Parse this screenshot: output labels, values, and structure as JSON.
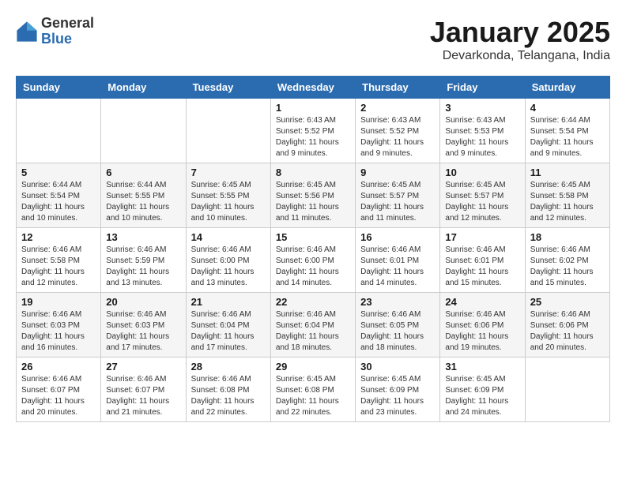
{
  "header": {
    "logo_general": "General",
    "logo_blue": "Blue",
    "month_title": "January 2025",
    "location": "Devarkonda, Telangana, India"
  },
  "days_of_week": [
    "Sunday",
    "Monday",
    "Tuesday",
    "Wednesday",
    "Thursday",
    "Friday",
    "Saturday"
  ],
  "weeks": [
    [
      {
        "day": "",
        "info": ""
      },
      {
        "day": "",
        "info": ""
      },
      {
        "day": "",
        "info": ""
      },
      {
        "day": "1",
        "info": "Sunrise: 6:43 AM\nSunset: 5:52 PM\nDaylight: 11 hours and 9 minutes."
      },
      {
        "day": "2",
        "info": "Sunrise: 6:43 AM\nSunset: 5:52 PM\nDaylight: 11 hours and 9 minutes."
      },
      {
        "day": "3",
        "info": "Sunrise: 6:43 AM\nSunset: 5:53 PM\nDaylight: 11 hours and 9 minutes."
      },
      {
        "day": "4",
        "info": "Sunrise: 6:44 AM\nSunset: 5:54 PM\nDaylight: 11 hours and 9 minutes."
      }
    ],
    [
      {
        "day": "5",
        "info": "Sunrise: 6:44 AM\nSunset: 5:54 PM\nDaylight: 11 hours and 10 minutes."
      },
      {
        "day": "6",
        "info": "Sunrise: 6:44 AM\nSunset: 5:55 PM\nDaylight: 11 hours and 10 minutes."
      },
      {
        "day": "7",
        "info": "Sunrise: 6:45 AM\nSunset: 5:55 PM\nDaylight: 11 hours and 10 minutes."
      },
      {
        "day": "8",
        "info": "Sunrise: 6:45 AM\nSunset: 5:56 PM\nDaylight: 11 hours and 11 minutes."
      },
      {
        "day": "9",
        "info": "Sunrise: 6:45 AM\nSunset: 5:57 PM\nDaylight: 11 hours and 11 minutes."
      },
      {
        "day": "10",
        "info": "Sunrise: 6:45 AM\nSunset: 5:57 PM\nDaylight: 11 hours and 12 minutes."
      },
      {
        "day": "11",
        "info": "Sunrise: 6:45 AM\nSunset: 5:58 PM\nDaylight: 11 hours and 12 minutes."
      }
    ],
    [
      {
        "day": "12",
        "info": "Sunrise: 6:46 AM\nSunset: 5:58 PM\nDaylight: 11 hours and 12 minutes."
      },
      {
        "day": "13",
        "info": "Sunrise: 6:46 AM\nSunset: 5:59 PM\nDaylight: 11 hours and 13 minutes."
      },
      {
        "day": "14",
        "info": "Sunrise: 6:46 AM\nSunset: 6:00 PM\nDaylight: 11 hours and 13 minutes."
      },
      {
        "day": "15",
        "info": "Sunrise: 6:46 AM\nSunset: 6:00 PM\nDaylight: 11 hours and 14 minutes."
      },
      {
        "day": "16",
        "info": "Sunrise: 6:46 AM\nSunset: 6:01 PM\nDaylight: 11 hours and 14 minutes."
      },
      {
        "day": "17",
        "info": "Sunrise: 6:46 AM\nSunset: 6:01 PM\nDaylight: 11 hours and 15 minutes."
      },
      {
        "day": "18",
        "info": "Sunrise: 6:46 AM\nSunset: 6:02 PM\nDaylight: 11 hours and 15 minutes."
      }
    ],
    [
      {
        "day": "19",
        "info": "Sunrise: 6:46 AM\nSunset: 6:03 PM\nDaylight: 11 hours and 16 minutes."
      },
      {
        "day": "20",
        "info": "Sunrise: 6:46 AM\nSunset: 6:03 PM\nDaylight: 11 hours and 17 minutes."
      },
      {
        "day": "21",
        "info": "Sunrise: 6:46 AM\nSunset: 6:04 PM\nDaylight: 11 hours and 17 minutes."
      },
      {
        "day": "22",
        "info": "Sunrise: 6:46 AM\nSunset: 6:04 PM\nDaylight: 11 hours and 18 minutes."
      },
      {
        "day": "23",
        "info": "Sunrise: 6:46 AM\nSunset: 6:05 PM\nDaylight: 11 hours and 18 minutes."
      },
      {
        "day": "24",
        "info": "Sunrise: 6:46 AM\nSunset: 6:06 PM\nDaylight: 11 hours and 19 minutes."
      },
      {
        "day": "25",
        "info": "Sunrise: 6:46 AM\nSunset: 6:06 PM\nDaylight: 11 hours and 20 minutes."
      }
    ],
    [
      {
        "day": "26",
        "info": "Sunrise: 6:46 AM\nSunset: 6:07 PM\nDaylight: 11 hours and 20 minutes."
      },
      {
        "day": "27",
        "info": "Sunrise: 6:46 AM\nSunset: 6:07 PM\nDaylight: 11 hours and 21 minutes."
      },
      {
        "day": "28",
        "info": "Sunrise: 6:46 AM\nSunset: 6:08 PM\nDaylight: 11 hours and 22 minutes."
      },
      {
        "day": "29",
        "info": "Sunrise: 6:45 AM\nSunset: 6:08 PM\nDaylight: 11 hours and 22 minutes."
      },
      {
        "day": "30",
        "info": "Sunrise: 6:45 AM\nSunset: 6:09 PM\nDaylight: 11 hours and 23 minutes."
      },
      {
        "day": "31",
        "info": "Sunrise: 6:45 AM\nSunset: 6:09 PM\nDaylight: 11 hours and 24 minutes."
      },
      {
        "day": "",
        "info": ""
      }
    ]
  ]
}
